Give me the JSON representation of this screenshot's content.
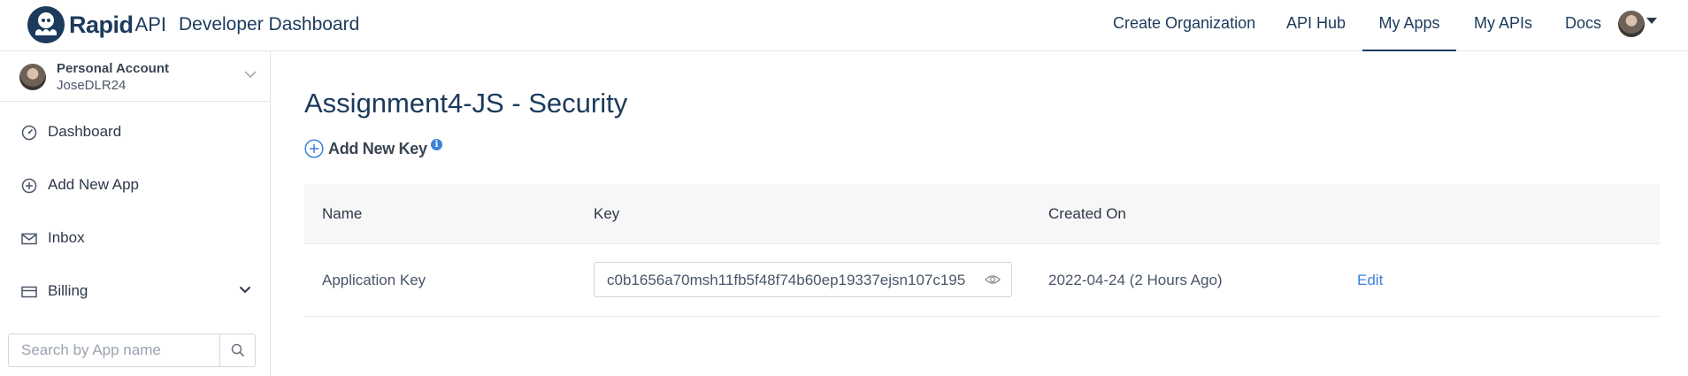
{
  "brand": {
    "name": "Rapid",
    "suffix": "API",
    "subtitle": "Developer Dashboard"
  },
  "nav": {
    "items": [
      {
        "label": "Create Organization",
        "active": false
      },
      {
        "label": "API Hub",
        "active": false
      },
      {
        "label": "My Apps",
        "active": true
      },
      {
        "label": "My APIs",
        "active": false
      },
      {
        "label": "Docs",
        "active": false
      }
    ]
  },
  "account": {
    "type": "Personal Account",
    "username": "JoseDLR24"
  },
  "sidebar": {
    "items": [
      {
        "label": "Dashboard",
        "icon": "dashboard-icon"
      },
      {
        "label": "Add New App",
        "icon": "plus-circle-icon"
      },
      {
        "label": "Inbox",
        "icon": "mail-icon"
      },
      {
        "label": "Billing",
        "icon": "billing-icon"
      }
    ],
    "search_placeholder": "Search by App name"
  },
  "main": {
    "title": "Assignment4-JS - Security",
    "add_key_label": "Add New Key",
    "info_glyph": "i",
    "table": {
      "headers": [
        "Name",
        "Key",
        "Created On"
      ],
      "rows": [
        {
          "name": "Application Key",
          "key": "c0b1656a70msh11fb5f48f74b60ep19337ejsn107c195",
          "created_on": "2022-04-24 (2 Hours Ago)",
          "action": "Edit"
        }
      ]
    }
  },
  "colors": {
    "brand_navy": "#1b3a5c",
    "link_blue": "#3b82d8",
    "header_bg": "#f7f7f8"
  }
}
